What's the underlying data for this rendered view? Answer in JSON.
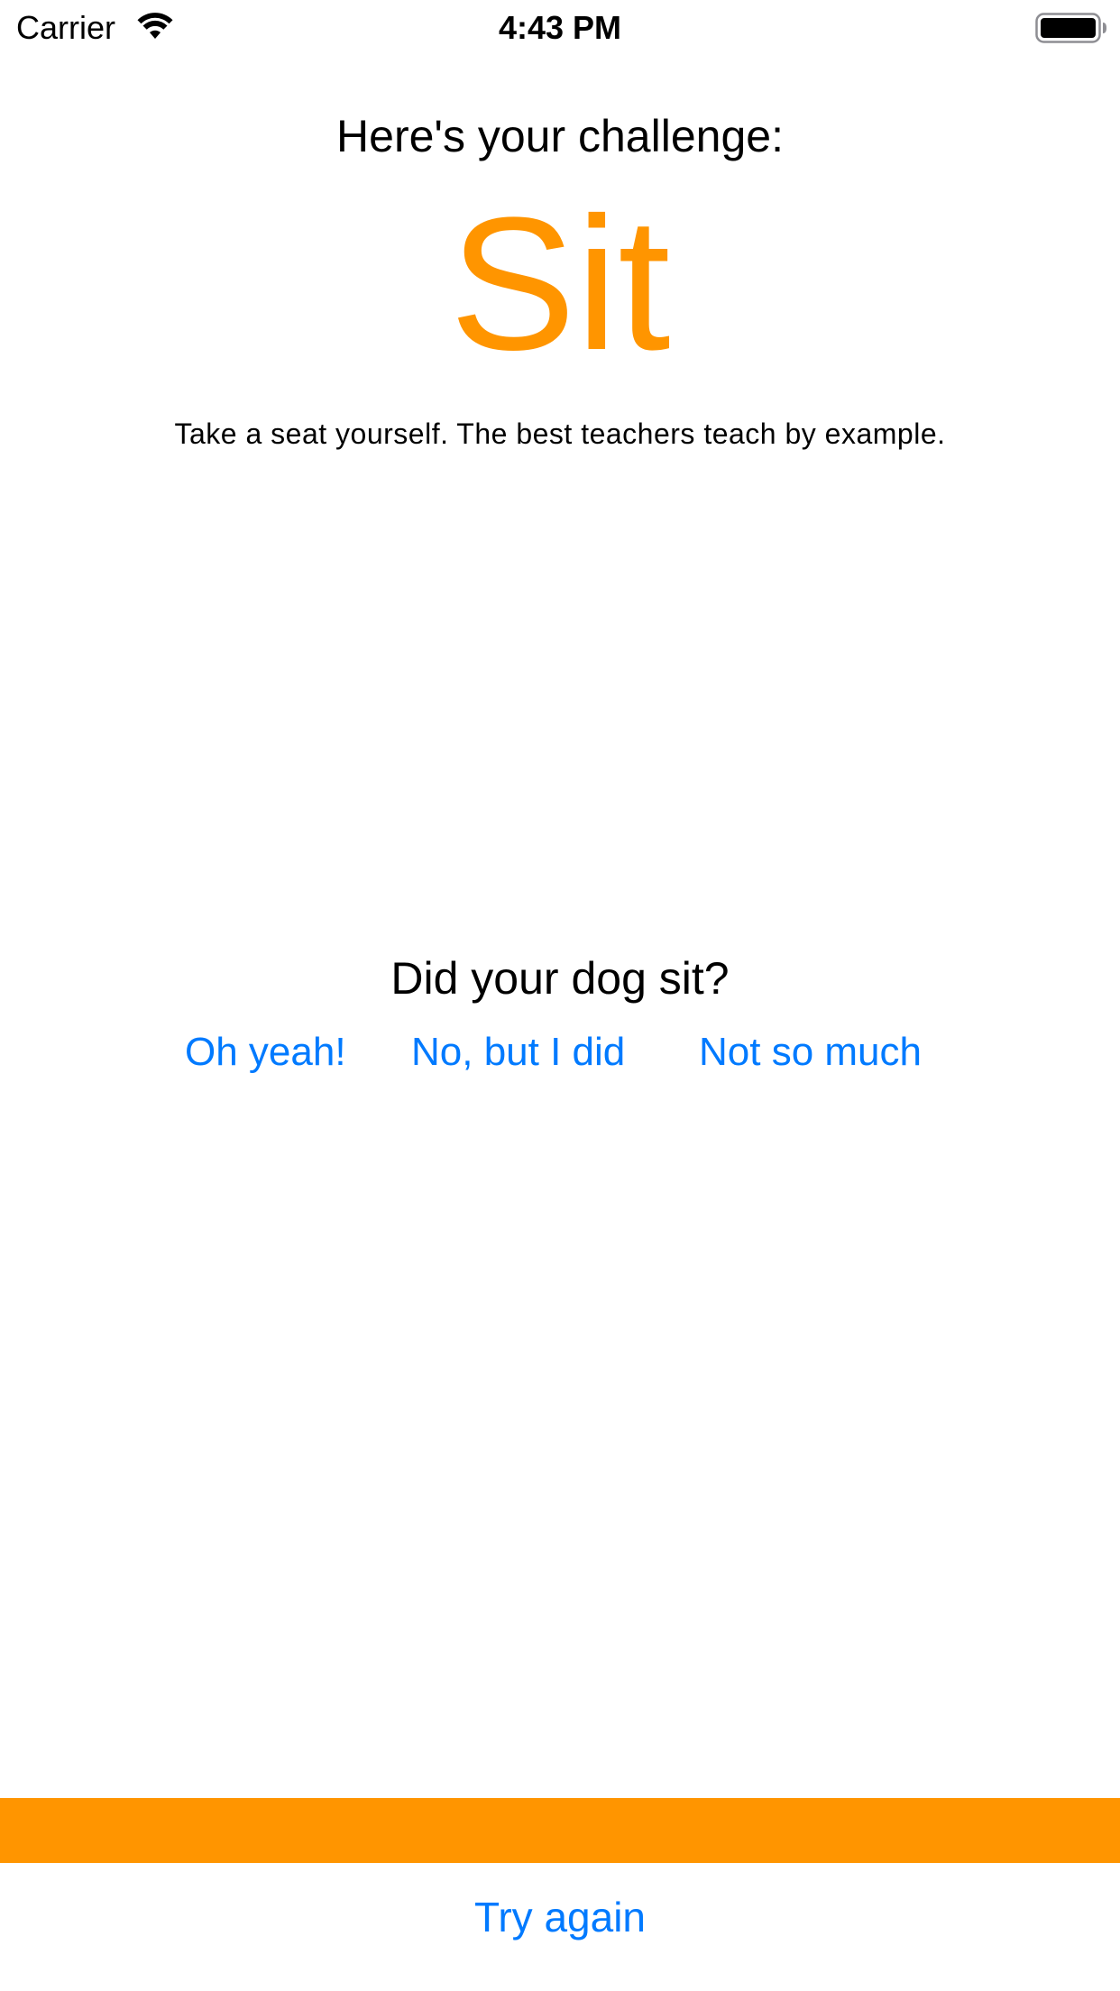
{
  "status_bar": {
    "carrier": "Carrier",
    "time": "4:43 PM",
    "wifi_icon": "wifi-icon",
    "battery_icon": "battery-icon"
  },
  "challenge": {
    "heading": "Here's your challenge:",
    "command": "Sit",
    "tip": "Take a seat yourself. The best teachers teach by example."
  },
  "question": {
    "text": "Did your dog sit?",
    "answers": [
      "Oh yeah!",
      "No, but I did",
      "Not so much"
    ]
  },
  "progress": {
    "fraction": 1.0
  },
  "footer": {
    "try_again_label": "Try again"
  },
  "colors": {
    "accent_orange": "#ff9500",
    "link_blue": "#007aff",
    "text": "#000000",
    "background": "#ffffff"
  }
}
